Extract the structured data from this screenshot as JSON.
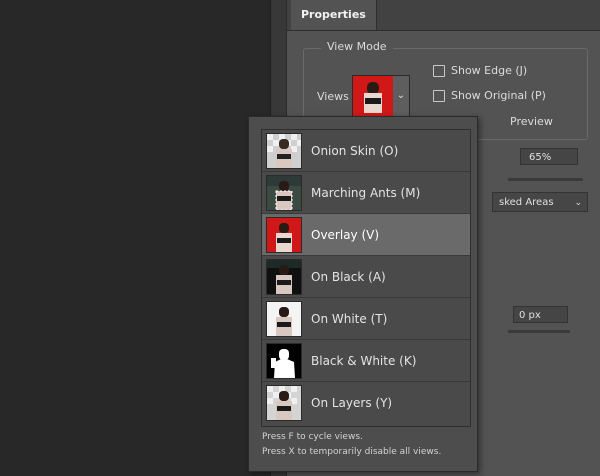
{
  "panel": {
    "tab_label": "Properties",
    "view_mode_label": "View Mode",
    "views_label": "Views",
    "show_edge_label": "Show Edge (J)",
    "show_original_label": "Show Original (P)",
    "preview_label": "Preview",
    "opacity_value": "65%",
    "mask_select_value": "sked Areas",
    "radius_value": "0 px"
  },
  "popup": {
    "items": [
      {
        "label": "Onion Skin (O)",
        "thumb": "onion-skin-thumbnail"
      },
      {
        "label": "Marching Ants (M)",
        "thumb": "marching-ants-thumbnail"
      },
      {
        "label": "Overlay (V)",
        "thumb": "overlay-thumbnail",
        "selected": true
      },
      {
        "label": "On Black (A)",
        "thumb": "on-black-thumbnail"
      },
      {
        "label": "On White (T)",
        "thumb": "on-white-thumbnail"
      },
      {
        "label": "Black & White (K)",
        "thumb": "black-white-thumbnail"
      },
      {
        "label": "On Layers (Y)",
        "thumb": "on-layers-thumbnail"
      }
    ],
    "hint_1": "Press F to cycle views.",
    "hint_2": "Press X to temporarily disable all views."
  },
  "colors": {
    "overlay_red": "#d01818",
    "selected_row": "#6a6a6a",
    "panel_bg": "#535353"
  }
}
